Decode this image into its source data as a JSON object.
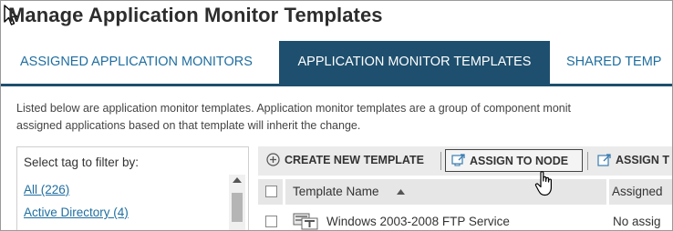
{
  "page": {
    "title": "Manage Application Monitor Templates"
  },
  "tabs": [
    {
      "label": "ASSIGNED APPLICATION MONITORS",
      "active": false
    },
    {
      "label": "APPLICATION MONITOR TEMPLATES",
      "active": true
    },
    {
      "label": "SHARED TEMP",
      "active": false
    }
  ],
  "description": {
    "line1": "Listed below are application monitor templates. Application monitor templates are a group of component monit",
    "line2": "assigned applications based on that template will inherit the change."
  },
  "filter": {
    "label": "Select tag to filter by:",
    "items": [
      {
        "label": "All (226)"
      },
      {
        "label": "Active Directory (4)"
      }
    ]
  },
  "toolbar": {
    "create_label": "CREATE NEW TEMPLATE",
    "assign_node_label": "ASSIGN TO NODE",
    "assign_truncated_label": "ASSIGN T"
  },
  "table": {
    "columns": {
      "name": "Template Name",
      "assigned": "Assigned"
    },
    "rows": [
      {
        "name": "Windows 2003-2008 FTP Service",
        "assigned": "No assig"
      }
    ]
  },
  "colors": {
    "active_tab_bg": "#1e4f6e",
    "link": "#1f6ea0",
    "toolbar_bg": "#ebebeb"
  },
  "icons": [
    "cursor-arrow-icon",
    "plus-circle-icon",
    "assign-node-icon",
    "external-assign-icon",
    "sort-ascending-icon",
    "template-icon",
    "hand-pointer-icon"
  ]
}
